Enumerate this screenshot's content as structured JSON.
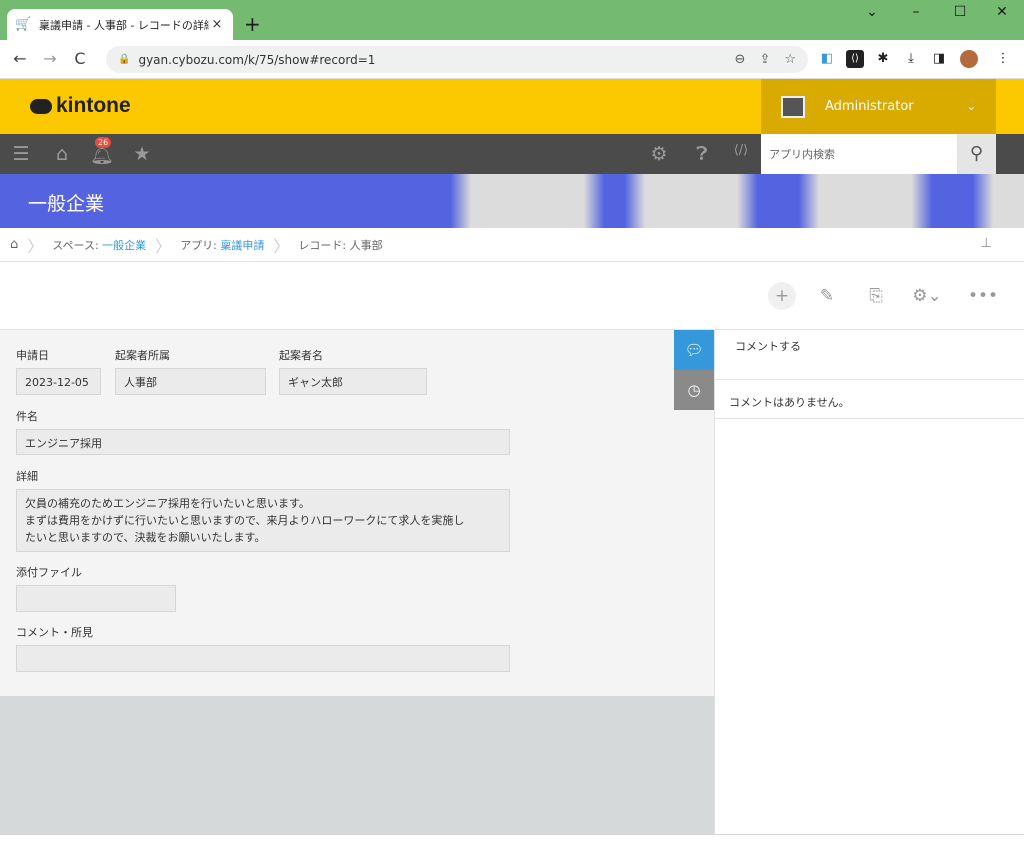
{
  "browser": {
    "tab_title": "稟議申請 - 人事部 - レコードの詳細",
    "tab_close": "×",
    "new_tab": "+",
    "url": "gyan.cybozu.com/k/75/show#record=1",
    "window_controls": [
      "⌄",
      "–",
      "☐",
      "✕"
    ]
  },
  "header": {
    "logo": "kintone",
    "user_name": "Administrator",
    "notification_count": "26",
    "search_placeholder": "アプリ内検索"
  },
  "space": {
    "name": "一般企業"
  },
  "breadcrumb": {
    "space_prefix": "スペース: ",
    "space_name": "一般企業",
    "app_prefix": "アプリ: ",
    "app_name": "稟議申請",
    "record_label": "レコード: 人事部"
  },
  "form": {
    "date_label": "申請日",
    "date_value": "2023-12-05",
    "dept_label": "起案者所属",
    "dept_value": "人事部",
    "author_label": "起案者名",
    "author_value": "ギャン太郎",
    "subject_label": "件名",
    "subject_value": "エンジニア採用",
    "detail_label": "詳細",
    "detail_line1": "欠員の補充のためエンジニア採用を行いたいと思います。",
    "detail_line2": "まずは費用をかけずに行いたいと思いますので、来月よりハローワークにて求人を実施し",
    "detail_line3": "たいと思いますので、決裁をお願いいたします。",
    "attachment_label": "添付ファイル",
    "comment_label": "コメント・所見"
  },
  "sidebar": {
    "comment_placeholder": "コメントする",
    "no_comments": "コメントはありません。"
  },
  "colors": {
    "chrome": "#74ba70",
    "kintone_yellow": "#fcc800",
    "user_box": "#d9aa00",
    "nav_dark": "#4b4b4b",
    "space_blue": "#5464e0",
    "active_tab": "#3498db",
    "link": "#3498db"
  }
}
